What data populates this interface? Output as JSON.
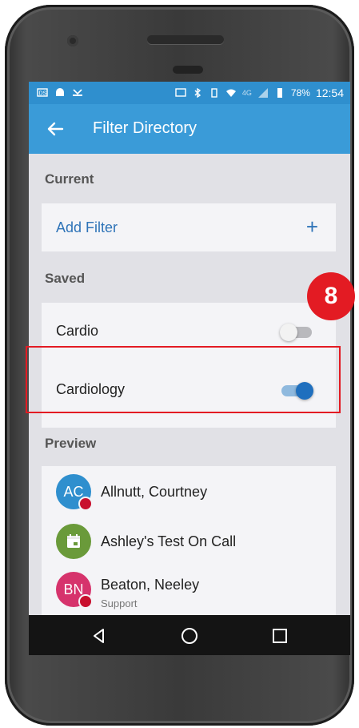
{
  "status_bar": {
    "battery": "78%",
    "time": "12:54",
    "network": "4G"
  },
  "app_bar": {
    "title": "Filter Directory",
    "back_icon": "arrow-left-icon"
  },
  "sections": {
    "current_label": "Current",
    "saved_label": "Saved",
    "preview_label": "Preview"
  },
  "current": {
    "add_filter_label": "Add Filter",
    "add_icon": "plus-icon"
  },
  "saved_filters": [
    {
      "label": "Cardio",
      "enabled": false
    },
    {
      "label": "Cardiology",
      "enabled": true
    }
  ],
  "annotation": {
    "step_number": "8"
  },
  "preview": [
    {
      "initials": "AC",
      "name": "Allnutt, Courtney",
      "subtitle": "",
      "avatar_color": "#2f8fce",
      "presence": true
    },
    {
      "initials": "",
      "name": "Ashley's Test On Call",
      "subtitle": "",
      "avatar_color": "#6a9a3a",
      "icon": "calendar-icon",
      "presence": false
    },
    {
      "initials": "BN",
      "name": "Beaton, Neeley",
      "subtitle": "Support",
      "avatar_color": "#d6336c",
      "presence": true
    }
  ],
  "colors": {
    "appbar": "#3a9bd8",
    "statusbar": "#2f8fce",
    "accent": "#2f74b8",
    "highlight": "#e31b23"
  }
}
